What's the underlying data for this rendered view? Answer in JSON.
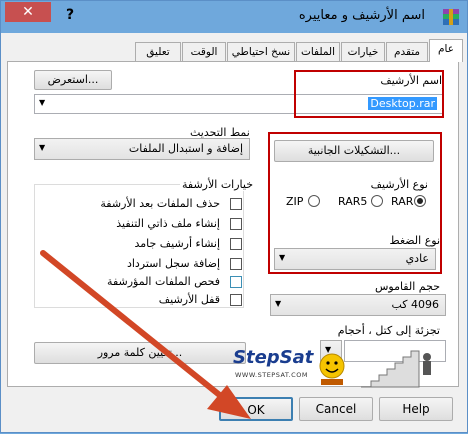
{
  "window": {
    "title": "اسم الأرشيف و معاييره",
    "help_glyph": "?",
    "close_glyph": "✕"
  },
  "tabs": [
    {
      "label": "عام"
    },
    {
      "label": "متقدم"
    },
    {
      "label": "خيارات"
    },
    {
      "label": "الملفات"
    },
    {
      "label": "نسخ احتياطي"
    },
    {
      "label": "الوقت"
    },
    {
      "label": "تعليق"
    }
  ],
  "general": {
    "archive_name_label": "اسم الأرشيف",
    "browse_button": "استعرض...",
    "archive_name_value": "Desktop.rar",
    "update_mode_label": "نمط التحديث",
    "update_mode_value": "إضافة و استبدال الملفات",
    "profiles_button": "التشكيلات الجانبية...",
    "archive_format_label": "نوع الأرشيف",
    "formats": [
      {
        "label": "RAR",
        "selected": true
      },
      {
        "label": "RAR5",
        "selected": false
      },
      {
        "label": "ZIP",
        "selected": false
      }
    ],
    "compression_label": "نوع الضغط",
    "compression_value": "عادي",
    "dictionary_label": "حجم القاموس",
    "dictionary_value": "4096 كب",
    "split_label": "تجزئة إلى كتل ، أحجام",
    "password_button": "تعيين كلمة مرور...",
    "archive_options_title": "خيارات الأرشفة",
    "options": [
      {
        "label": "حذف الملفات بعد الأرشفة",
        "checked": false
      },
      {
        "label": "إنشاء ملف ذاتي التنفيذ",
        "checked": false
      },
      {
        "label": "إنشاء أرشيف جامد",
        "checked": false
      },
      {
        "label": "إضافة سجل استرداد",
        "checked": false
      },
      {
        "label": "فحص الملفات المؤرشفة",
        "checked": false
      },
      {
        "label": "قفل الأرشيف",
        "checked": false
      }
    ]
  },
  "watermark": {
    "brand": "StepSat",
    "url": "WWW.STEPSAT.COM"
  },
  "footer": {
    "ok": "OK",
    "cancel": "Cancel",
    "help": "Help"
  },
  "colors": {
    "accent_red": "#c00000",
    "arrow": "#d24726",
    "titlebar": "#6fa8dc",
    "selection": "#3399ff"
  }
}
